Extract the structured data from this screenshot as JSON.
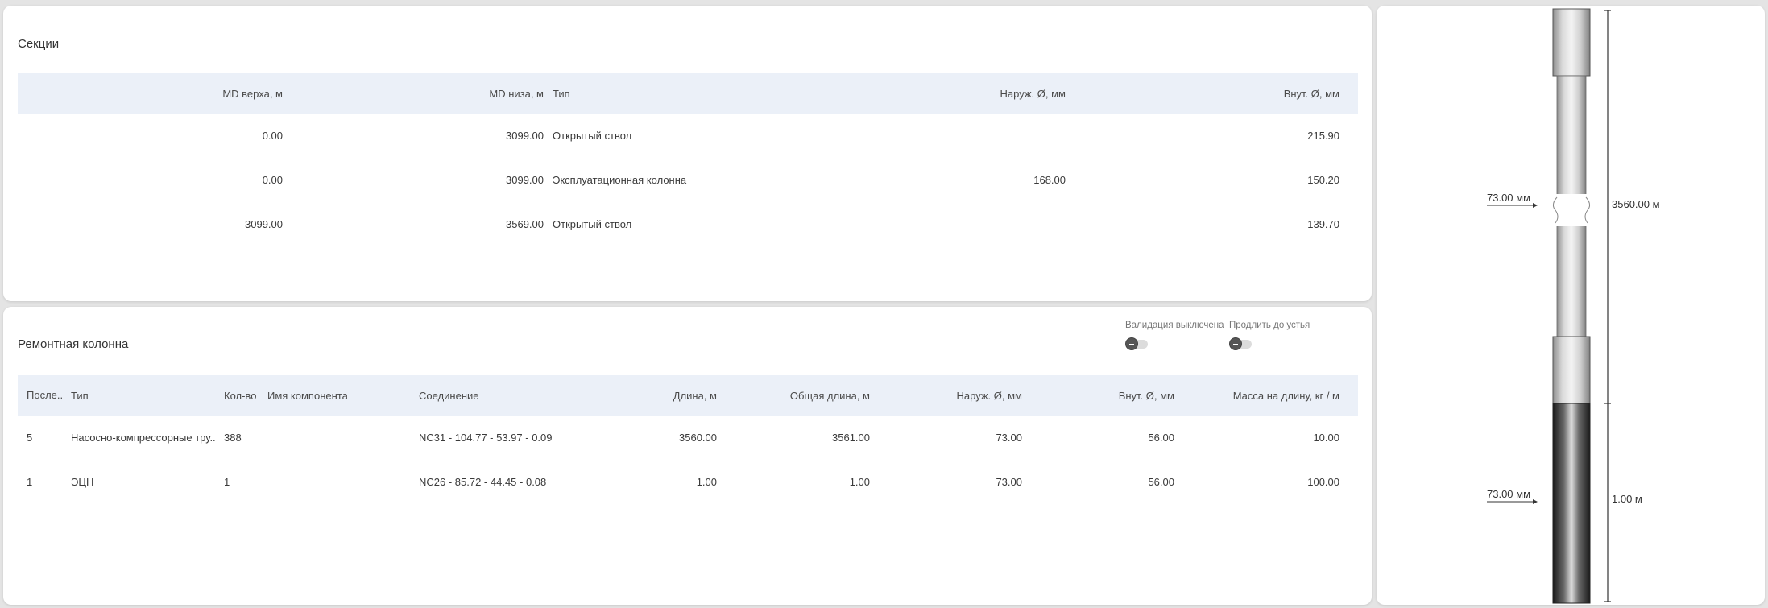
{
  "sections": {
    "title": "Секции",
    "columns": {
      "md_top": "MD верха, м",
      "md_bottom": "MD низа, м",
      "type": "Тип",
      "outer_d": "Наруж. Ø, мм",
      "inner_d": "Внут. Ø, мм"
    },
    "rows": [
      {
        "md_top": "0.00",
        "md_bottom": "3099.00",
        "type": "Открытый ствол",
        "outer_d": "",
        "inner_d": "215.90"
      },
      {
        "md_top": "0.00",
        "md_bottom": "3099.00",
        "type": "Эксплуатационная колонна",
        "outer_d": "168.00",
        "inner_d": "150.20"
      },
      {
        "md_top": "3099.00",
        "md_bottom": "3569.00",
        "type": "Открытый ствол",
        "outer_d": "",
        "inner_d": "139.70"
      }
    ]
  },
  "repair": {
    "title": "Ремонтная колонна",
    "toggles": {
      "validation_label": "Валидация выключена",
      "extend_label": "Продлить до устья"
    },
    "columns": {
      "seq": "После...",
      "type": "Тип",
      "qty": "Кол-во",
      "component": "Имя компонента",
      "connection": "Соединение",
      "length": "Длина, м",
      "total_length": "Общая длина, м",
      "outer_d": "Наруж. Ø, мм",
      "inner_d": "Внут. Ø, мм",
      "mass": "Масса на длину, кг / м"
    },
    "rows": [
      {
        "seq": "5",
        "type": "Насосно-компрессорные тру...",
        "qty": "388",
        "component": "",
        "connection": "NC31 - 104.77 - 53.97 - 0.09",
        "length": "3560.00",
        "total_length": "3561.00",
        "outer_d": "73.00",
        "inner_d": "56.00",
        "mass": "10.00"
      },
      {
        "seq": "1",
        "type": "ЭЦН",
        "qty": "1",
        "component": "",
        "connection": "NC26 - 85.72 - 44.45 - 0.08",
        "length": "1.00",
        "total_length": "1.00",
        "outer_d": "73.00",
        "inner_d": "56.00",
        "mass": "100.00"
      }
    ]
  },
  "schematic": {
    "upper_diameter": "73.00 мм",
    "lower_diameter": "73.00 мм",
    "upper_length": "3560.00 м",
    "lower_length": "1.00 м"
  }
}
